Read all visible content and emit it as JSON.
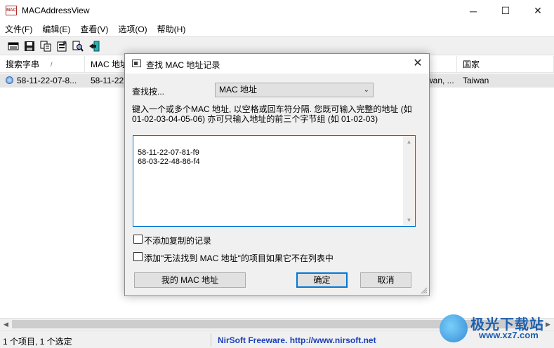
{
  "window": {
    "title": "MACAddressView",
    "icon_label": "MAC",
    "minimize": "─",
    "maximize": "☐",
    "close": "✕"
  },
  "menu": [
    "文件(F)",
    "编辑(E)",
    "查看(V)",
    "选项(O)",
    "帮助(H)"
  ],
  "toolbar": {
    "icons": [
      "view-report-icon",
      "save-icon",
      "copy-icon",
      "properties-icon",
      "find-icon",
      "exit-icon"
    ]
  },
  "table": {
    "columns": [
      "搜索字串",
      "MAC 地址",
      "国家"
    ],
    "sort_indicator": "/",
    "rows": [
      {
        "search": "58-11-22-07-8...",
        "mac": "58-11-22",
        "company": "wan, ...",
        "country": "Taiwan"
      }
    ]
  },
  "status": {
    "left": "1 个项目, 1 个选定",
    "right": "NirSoft Freeware.  http://www.nirsoft.net"
  },
  "watermark": {
    "text1": "极光下载站",
    "text2": "www.xz7.com"
  },
  "dialog": {
    "title": "查找 MAC 地址记录",
    "close": "✕",
    "find_by_label": "查找按...",
    "find_by_value": "MAC 地址",
    "description_line1": "键入一个或多个MAC 地址, 以空格或回车符分隔. 您既可输入完整的地址 (如",
    "description_line2": "01-02-03-04-05-06) 亦可只输入地址的前三个字节组 (如 01-02-03)",
    "mac_text": "58-11-22-07-81-f9\n68-03-22-48-86-f4",
    "checkbox1": "不添加复制的记录",
    "checkbox2": "添加\"无法找到 MAC 地址\"的项目如果它不在列表中",
    "my_mac_button": "我的 MAC 地址",
    "ok_button": "确定",
    "cancel_button": "取消"
  }
}
